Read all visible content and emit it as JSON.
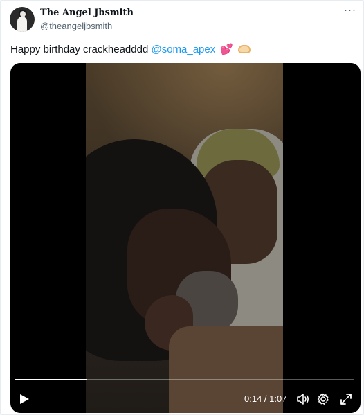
{
  "author": {
    "display_name": "The Angel Jbsmith",
    "handle": "@theangeljbsmith",
    "avatar_icon": "avatar-photo"
  },
  "menu": {
    "more_label": "···",
    "icon": "more-icon"
  },
  "tweet": {
    "text": "Happy birthday crackheadddd ",
    "mention": "@soma_apex",
    "emoji_1": "💕",
    "emoji_2_icon": "heart-hands-icon"
  },
  "video": {
    "progress": 0.21,
    "current_time": "0:14",
    "separator": " / ",
    "duration": "1:07",
    "controls": {
      "play_icon": "play-icon",
      "volume_icon": "volume-icon",
      "settings_icon": "gear-icon",
      "fullscreen_icon": "expand-icon"
    }
  },
  "colors": {
    "accent": "#1d9bf0",
    "text_primary": "#0f1419",
    "text_secondary": "#536471",
    "video_bg": "#000000"
  }
}
